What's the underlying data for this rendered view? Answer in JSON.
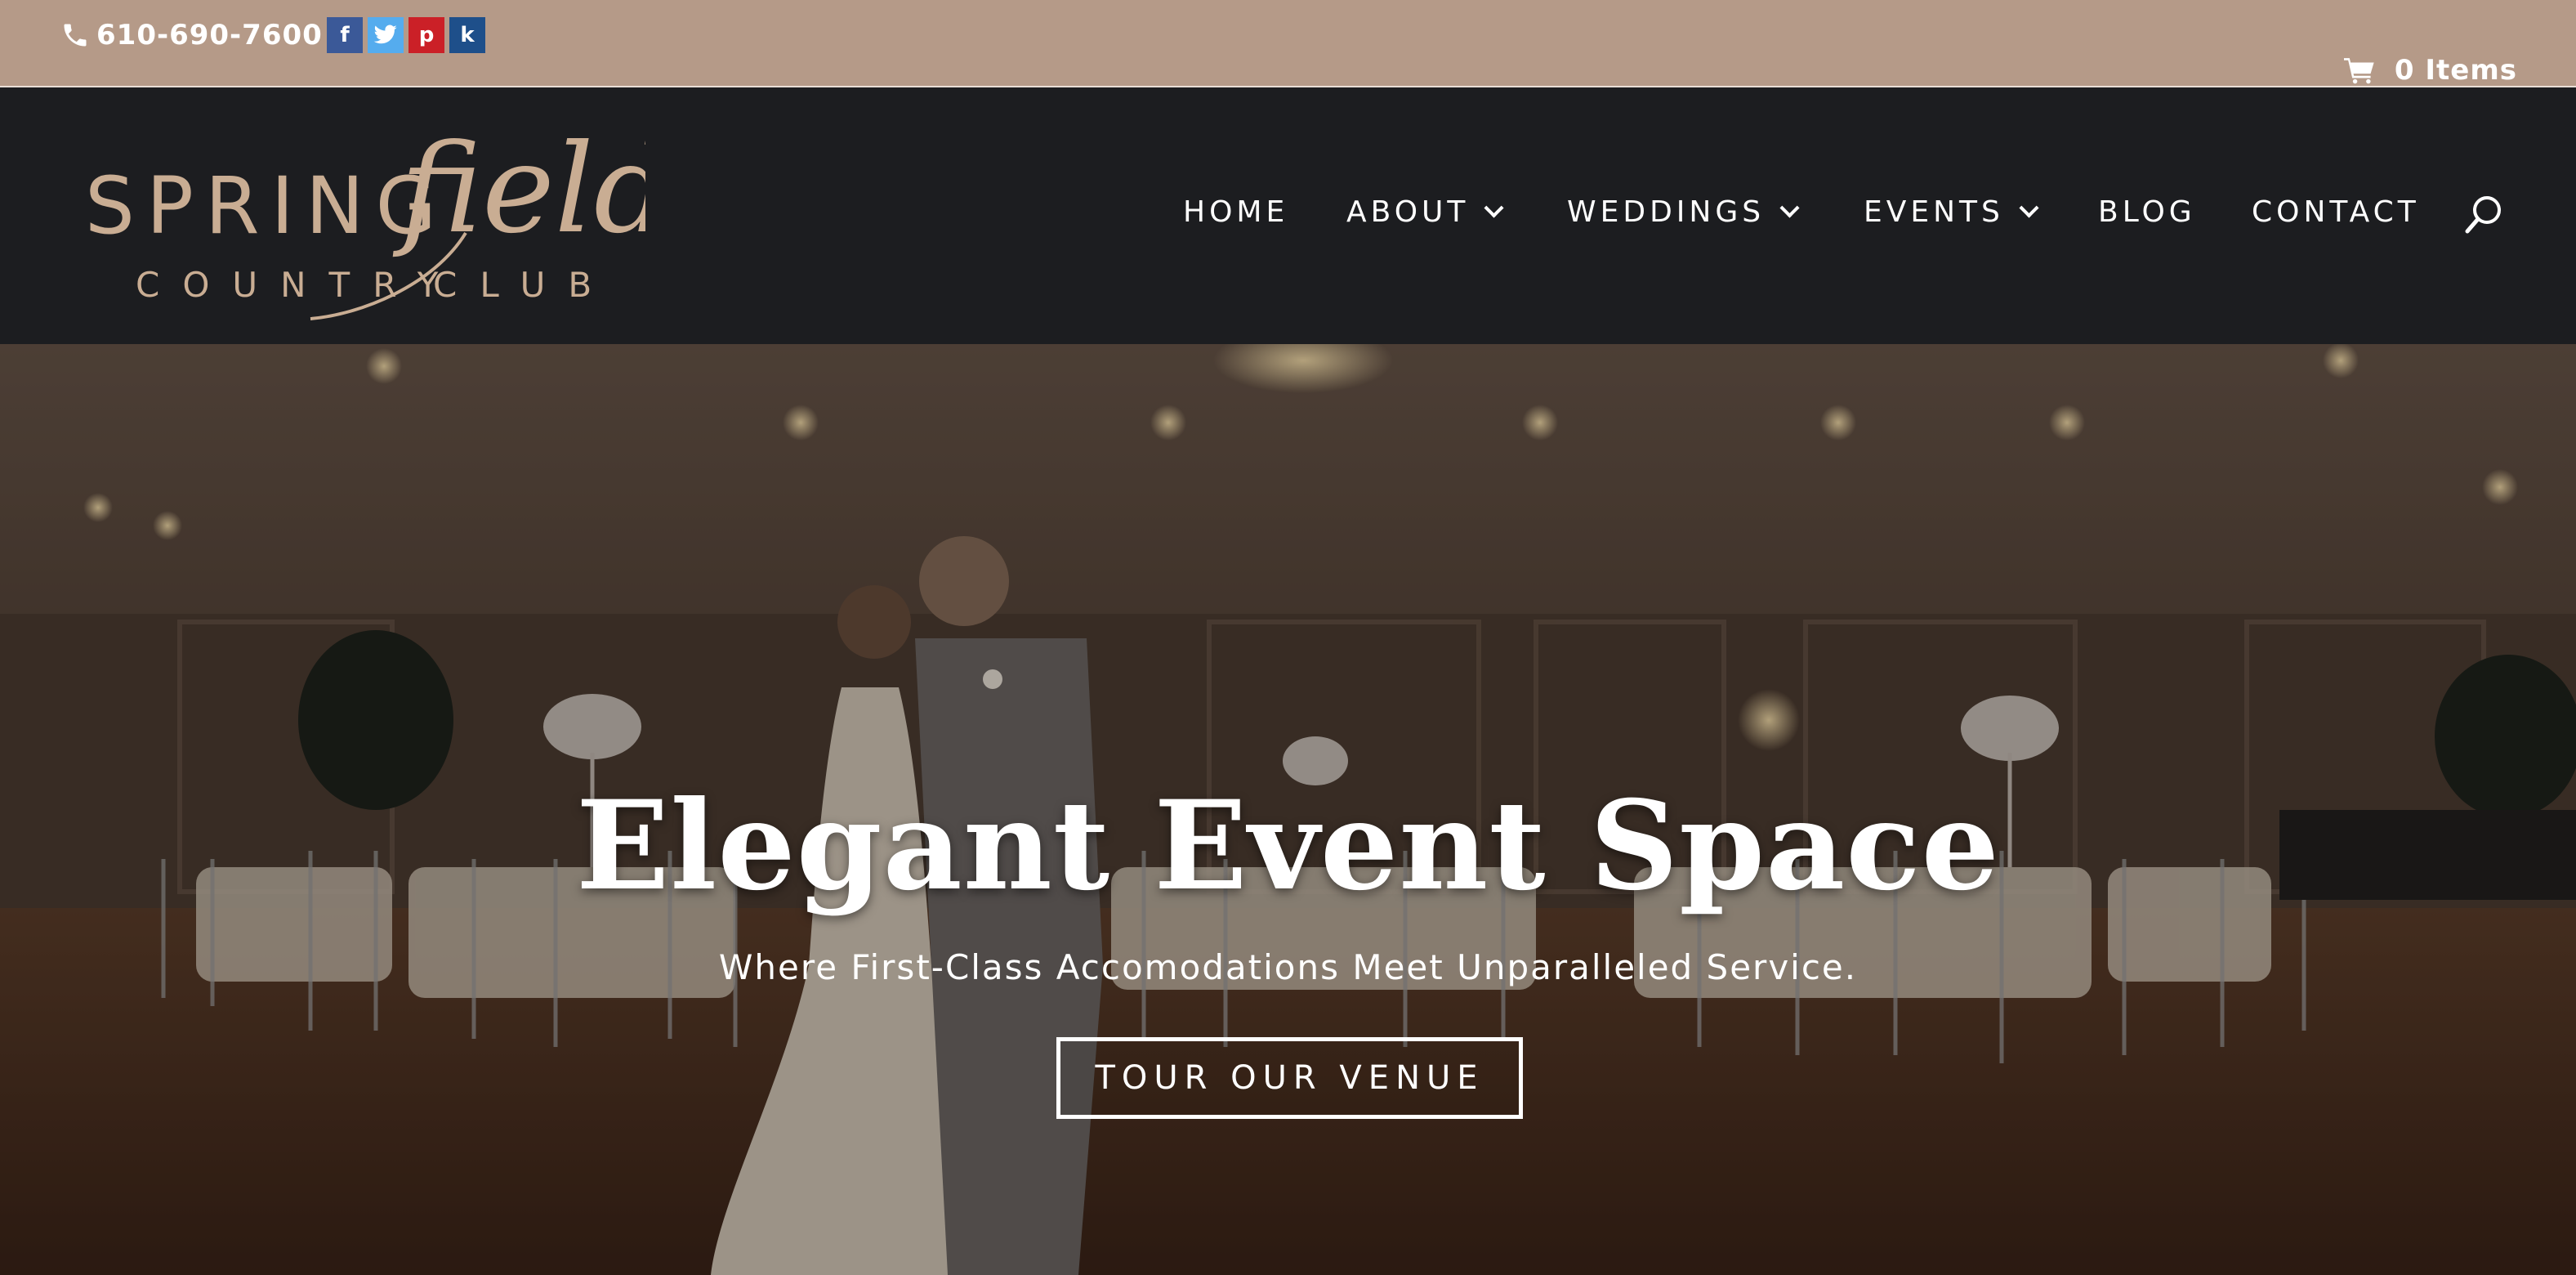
{
  "topbar": {
    "phone": "610-690-7600",
    "cart_label": "0 Items",
    "socials": {
      "facebook": "f",
      "twitter": "t",
      "pinterest": "p",
      "knot": "k"
    }
  },
  "logo": {
    "word_spring": "SPRING",
    "word_field": "field",
    "word_country": "COUNTRY",
    "word_club": "CLUB"
  },
  "nav": {
    "home": "HOME",
    "about": "ABOUT",
    "weddings": "WEDDINGS",
    "events": "EVENTS",
    "blog": "BLOG",
    "contact": "CONTACT"
  },
  "hero": {
    "title": "Elegant Event Space",
    "subtitle": "Where First-Class Accomodations Meet Unparalleled Service.",
    "button": "TOUR OUR VENUE"
  },
  "colors": {
    "topbar": "#b59a88",
    "header": "#1c1d20",
    "logo_gold": "#c9ad93",
    "accent_white": "#ffffff"
  },
  "icons": [
    "phone-icon",
    "facebook-icon",
    "twitter-icon",
    "pinterest-icon",
    "knot-icon",
    "cart-icon",
    "search-icon",
    "chevron-down-icon"
  ]
}
